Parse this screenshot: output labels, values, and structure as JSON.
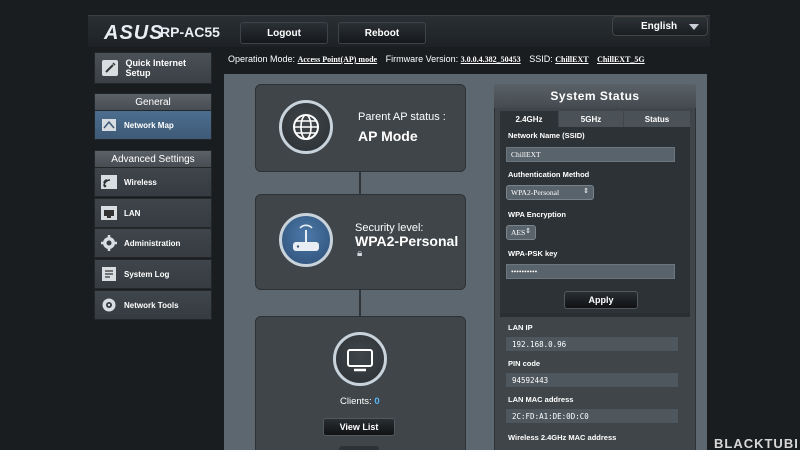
{
  "header": {
    "brand": "ASUS",
    "model": "RP-AC55",
    "logout_label": "Logout",
    "reboot_label": "Reboot",
    "language": "English"
  },
  "opbar": {
    "mode_label": "Operation Mode:",
    "mode_value": "Access Point(AP) mode",
    "firmware_label": "Firmware Version:",
    "firmware_value": "3.0.0.4.382_50453",
    "ssid_label": "SSID:",
    "ssid_1": "ChillEXT",
    "ssid_2": "ChillEXT_5G"
  },
  "sidebar": {
    "quick_setup": "Quick Internet Setup",
    "general_header": "General",
    "network_map": "Network Map",
    "advanced_header": "Advanced Settings",
    "items": [
      {
        "label": "Wireless"
      },
      {
        "label": "LAN"
      },
      {
        "label": "Administration"
      },
      {
        "label": "System Log"
      },
      {
        "label": "Network Tools"
      }
    ]
  },
  "map": {
    "parent_label": "Parent AP status :",
    "parent_value": "AP Mode",
    "security_label": "Security level:",
    "security_value": "WPA2-Personal",
    "clients_label": "Clients:",
    "clients_value": "0",
    "view_list_label": "View List"
  },
  "status": {
    "title": "System Status",
    "tabs": [
      "2.4GHz",
      "5GHz",
      "Status"
    ],
    "ssid_label": "Network Name (SSID)",
    "ssid_value": "ChillEXT",
    "auth_label": "Authentication Method",
    "auth_value": "WPA2-Personal",
    "enc_label": "WPA Encryption",
    "enc_value": "AES",
    "psk_label": "WPA-PSK key",
    "psk_value": "••••••••••",
    "apply_label": "Apply",
    "lan_ip_label": "LAN IP",
    "lan_ip_value": "192.168.0.96",
    "pin_label": "PIN code",
    "pin_value": "94592443",
    "mac_label": "LAN MAC address",
    "mac_value": "2C:FD:A1:DE:0D:C0",
    "wmac_label": "Wireless 2.4GHz MAC address"
  },
  "watermark": "BLACKTUBI"
}
